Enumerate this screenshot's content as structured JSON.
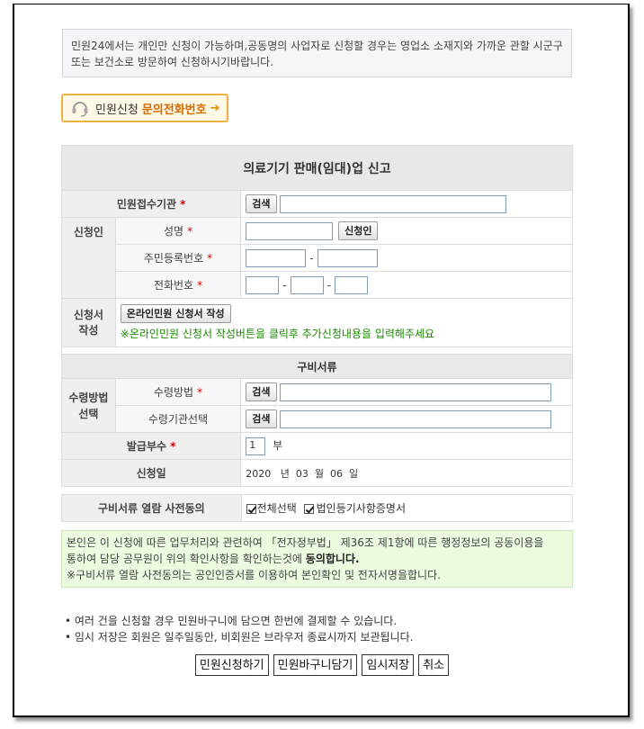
{
  "notice": "민원24에서는 개인만 신청이 가능하며,공동명의 사업자로 신청할 경우는 영업소 소재지와 가까운 관할 시군구 또는 보건소로 방문하여 신청하시기바랍니다.",
  "phone_button": {
    "label": "민원신청",
    "highlight": "문의전화번호",
    "arrow": "➔"
  },
  "form": {
    "title": "의료기기 판매(임대)업 신고",
    "required_mark": "*",
    "agency": {
      "label": "민원접수기관",
      "search_button": "검색",
      "value": ""
    },
    "applicant": {
      "label": "신청인",
      "name_label": "성명",
      "name_value": "",
      "applicant_button": "신청인",
      "rrn_label": "주민등록번호",
      "phone_label": "전화번호",
      "separator": "-"
    },
    "application": {
      "label_line1": "신청서",
      "label_line2": "작성",
      "write_button": "온라인민원 신청서 작성",
      "hint": "※온라인민원 신청서 작성버튼을 클릭후 추가신청내용을 입력해주세요"
    },
    "documents_title": "구비서류",
    "receive": {
      "label_line1": "수령방법",
      "label_line2": "선택",
      "method_label": "수령방법",
      "agency_label": "수령기관선택",
      "search_button": "검색"
    },
    "copies": {
      "label": "발급부수",
      "value": "1",
      "unit": "부"
    },
    "date": {
      "label": "신청일",
      "year": "2020",
      "year_unit": "년",
      "month": "03",
      "month_unit": "월",
      "day": "06",
      "day_unit": "일"
    }
  },
  "agreement": {
    "label": "구비서류 열람 사전동의",
    "select_all": "전체선택",
    "doc1": "법인등기사항증명서",
    "select_all_checked": true,
    "doc1_checked": true
  },
  "consent": {
    "line1": "본인은 이 신청에 따른 업무처리와 관련하여 「전자정부법」 제36조 제1항에 따른 행정정보의 공동이용을",
    "line2_a": "통하여 담당 공무원이 위의 확인사항을 확인하는것에 ",
    "line2_b": "동의합니다.",
    "line3": "※구비서류 열람 사전동의는 공인인증서를 이용하여 본인확인 및 전자서명을합니다."
  },
  "bullets": [
    "• 여러 건을 신청할 경우 민원바구니에 담으면 한번에 결제할 수 있습니다.",
    "• 임시 저장은 회원은 일주일동안, 비회원은 브라우저 종료시까지 보관됩니다."
  ],
  "actions": {
    "apply": "민원신청하기",
    "basket": "민원바구니담기",
    "temp_save": "임시저장",
    "cancel": "취소"
  }
}
